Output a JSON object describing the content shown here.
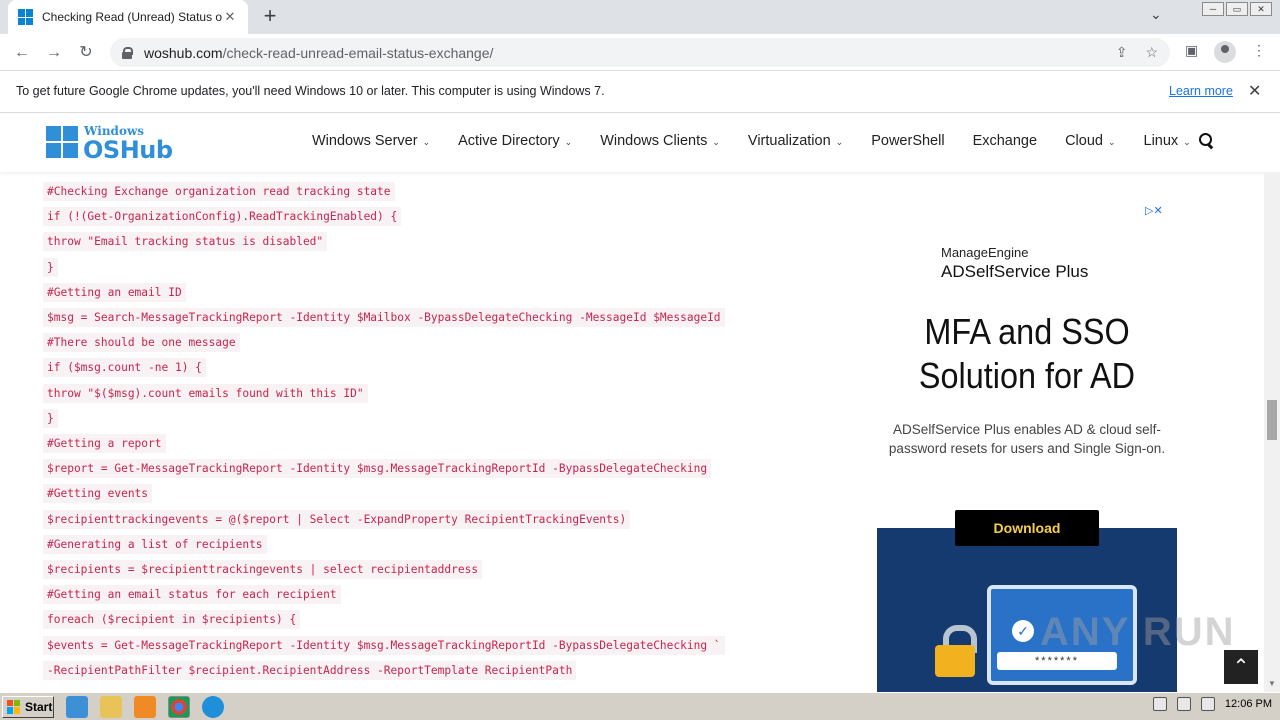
{
  "browser": {
    "tab_title": "Checking Read (Unread) Status of E",
    "tab_close": "✕",
    "new_tab": "+",
    "tab_dropdown": "⌄",
    "window_controls": [
      "─",
      "▭",
      "✕"
    ],
    "url_host": "woshub.com",
    "url_path": "/check-read-unread-email-status-exchange/",
    "nav_back": "←",
    "nav_forward": "→",
    "nav_reload": "↻",
    "share_icon": "⇪",
    "star_icon": "☆",
    "sidepanel_icon": "▣",
    "menu_icon": "⋮"
  },
  "infobar": {
    "message": "To get future Google Chrome updates, you'll need Windows 10 or later. This computer is using Windows 7.",
    "link": "Learn more",
    "close": "✕"
  },
  "site": {
    "logo_top": "Windows",
    "logo_bottom": "OSHub",
    "nav": [
      {
        "label": "Windows Server",
        "chevron": "⌄"
      },
      {
        "label": "Active Directory",
        "chevron": "⌄"
      },
      {
        "label": "Windows Clients",
        "chevron": "⌄"
      },
      {
        "label": "Virtualization",
        "chevron": "⌄"
      },
      {
        "label": "PowerShell",
        "chevron": ""
      },
      {
        "label": "Exchange",
        "chevron": ""
      },
      {
        "label": "Cloud",
        "chevron": "⌄"
      },
      {
        "label": "Linux",
        "chevron": "⌄"
      }
    ]
  },
  "code_lines": [
    "#Checking Exchange organization read tracking state",
    "if (!(Get-OrganizationConfig).ReadTrackingEnabled) {",
    "throw \"Email tracking status is disabled\"",
    "}",
    "#Getting an email ID",
    "$msg = Search-MessageTrackingReport -Identity $Mailbox -BypassDelegateChecking -MessageId $MessageId",
    "#There should be one message",
    "if ($msg.count -ne 1) {",
    "throw \"$($msg).count emails found with this ID\"",
    "}",
    "#Getting a report",
    "$report = Get-MessageTrackingReport -Identity $msg.MessageTrackingReportId -BypassDelegateChecking",
    "#Getting events",
    "$recipienttrackingevents = @($report | Select -ExpandProperty RecipientTrackingEvents)",
    "#Generating a list of recipients",
    "$recipients = $recipienttrackingevents | select recipientaddress",
    "#Getting an email status for each recipient",
    "foreach ($recipient in $recipients) {",
    "$events = Get-MessageTrackingReport -Identity $msg.MessageTrackingReportId -BypassDelegateChecking `",
    "-RecipientPathFilter $recipient.RecipientAddress -ReportTemplate RecipientPath"
  ],
  "ad": {
    "adchoices": "▷✕",
    "brand_line1": "ManageEngine",
    "brand_line2": "ADSelfService Plus",
    "headline_line1": "MFA and SSO",
    "headline_line2": "Solution for AD",
    "desc_line1": "ADSelfService Plus enables AD & cloud self-",
    "desc_line2": "password resets for users and Single Sign-on.",
    "button": "Download",
    "check": "✓",
    "password": "*******"
  },
  "watermark": "ANY RUN",
  "scrolltop": "⌃",
  "taskbar": {
    "start": "Start",
    "time": "12:06 PM"
  }
}
